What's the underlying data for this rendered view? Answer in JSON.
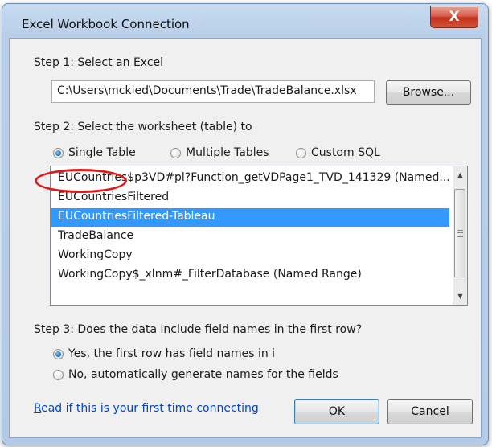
{
  "window": {
    "title": "Excel Workbook Connection",
    "close_label": "X"
  },
  "step1": {
    "label": "Step 1: Select an Excel",
    "path_value": "C:\\Users\\mckied\\Documents\\Trade\\TradeBalance.xlsx",
    "browse_label": "Browse..."
  },
  "step2": {
    "label": "Step 2: Select the worksheet (table) to",
    "options": [
      {
        "label": "Single Table",
        "selected": true
      },
      {
        "label": "Multiple Tables",
        "selected": false
      },
      {
        "label": "Custom SQL",
        "selected": false
      }
    ],
    "tables": [
      "EUCountries$p3VD#pl?Function_getVDPage1_TVD_141329 (Named...",
      "EUCountriesFiltered",
      "EUCountriesFiltered-Tableau",
      "TradeBalance",
      "WorkingCopy",
      "WorkingCopy$_xlnm#_FilterDatabase (Named Range)"
    ],
    "selected_index": 2
  },
  "step3": {
    "label": "Step 3: Does the data include field names in the first row?",
    "options": [
      {
        "label": "Yes, the first row has field names in i",
        "selected": true
      },
      {
        "label": "No, automatically generate names for the fields",
        "selected": false
      }
    ]
  },
  "footer": {
    "link_first": "R",
    "link_rest": "ead if this is your first time connecting",
    "ok_label": "OK",
    "cancel_label": "Cancel"
  },
  "colors": {
    "selection": "#3399ff",
    "link": "#0044cc",
    "annotation": "#e01818"
  }
}
